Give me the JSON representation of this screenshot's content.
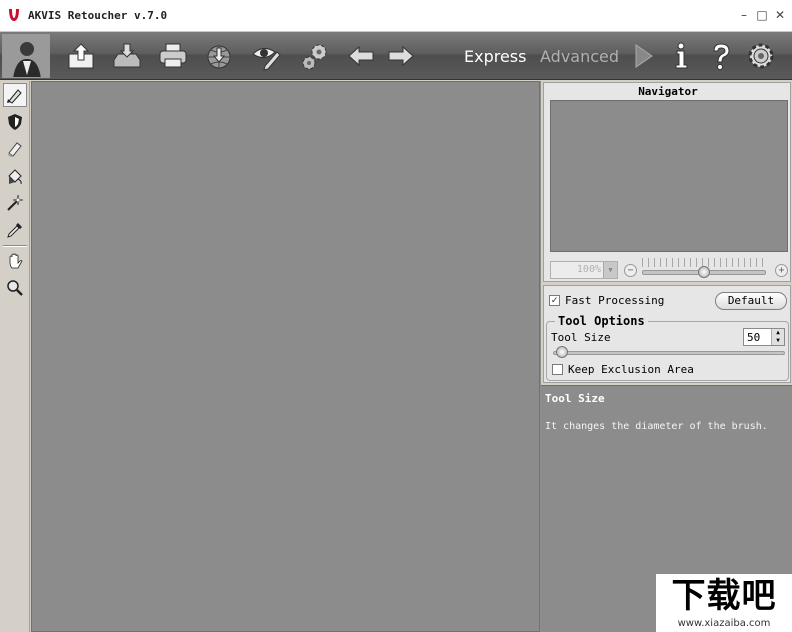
{
  "window": {
    "title": "AKVIS Retoucher v.7.0",
    "minimize": "–",
    "maximize": "□",
    "close": "✕"
  },
  "toolbar": {
    "buttons": [
      "open-image",
      "save-image",
      "print",
      "publish",
      "preferences-eye",
      "settings-gears",
      "undo",
      "redo"
    ],
    "modes": {
      "express": "Express",
      "advanced": "Advanced"
    },
    "right_buttons": [
      "run",
      "info",
      "help",
      "preferences"
    ]
  },
  "tools": [
    "retouch-brush",
    "exclusion-area",
    "eraser",
    "fill-bucket",
    "magic-wand",
    "eyedropper",
    "hand",
    "zoom"
  ],
  "navigator": {
    "title": "Navigator",
    "zoom_value": "100%",
    "zoom_minus": "−",
    "zoom_plus": "+",
    "zoom_level": 0.5
  },
  "options": {
    "fast_processing_label": "Fast Processing",
    "fast_processing_checked": "✓",
    "default_button": "Default",
    "tool_options_title": "Tool Options",
    "tool_size_label": "Tool Size",
    "tool_size_value": "50",
    "keep_exclusion_label": "Keep Exclusion Area",
    "keep_exclusion_checked": ""
  },
  "help": {
    "title": "Tool Size",
    "body": "It changes the diameter of the brush."
  },
  "watermark": {
    "mark": "下载吧",
    "url": "www.xiazaiba.com"
  },
  "colors": {
    "canvas": "#8c8c8c",
    "toolbar": "#5e5e5e",
    "panel": "#d4d0c8",
    "logo_red": "#c8102e"
  }
}
